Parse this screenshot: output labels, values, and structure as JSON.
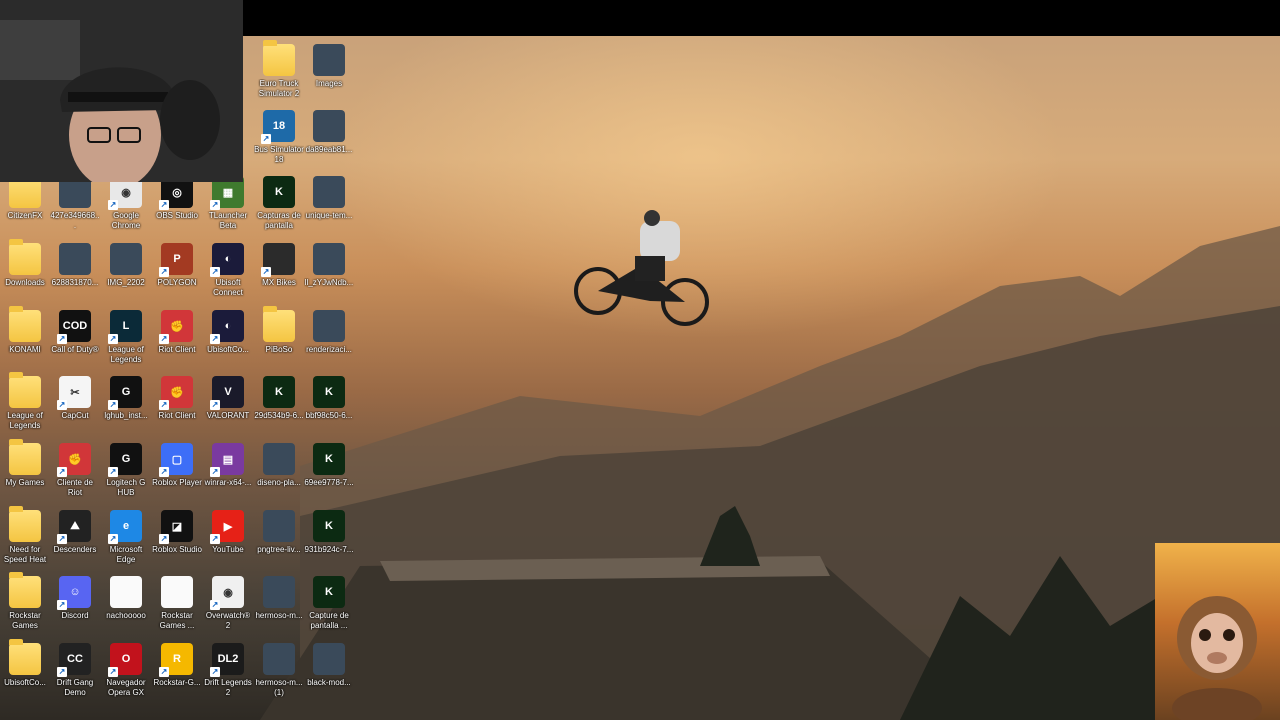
{
  "desktop": {
    "icons": [
      {
        "label": "Euro Truck Simulator 2",
        "icon": "folder-icon",
        "type": "folder"
      },
      {
        "label": "Images",
        "icon": "image-icon",
        "type": "image"
      },
      {
        "label": "Bus Simulator 18",
        "icon": "bus-simulator-icon",
        "type": "app"
      },
      {
        "label": "da89eab81...",
        "icon": "image-icon",
        "type": "image"
      },
      {
        "label": "CitizenFX",
        "icon": "folder-icon",
        "type": "folder"
      },
      {
        "label": "427e349668...",
        "icon": "image-icon",
        "type": "image"
      },
      {
        "label": "Google Chrome",
        "icon": "chrome-icon",
        "type": "app"
      },
      {
        "label": "OBS Studio",
        "icon": "obs-icon",
        "type": "app"
      },
      {
        "label": "TLauncher Beta",
        "icon": "tlauncher-icon",
        "type": "app"
      },
      {
        "label": "Capturas de pantalla",
        "icon": "kick-icon",
        "type": "image"
      },
      {
        "label": "unique-tem...",
        "icon": "image-icon",
        "type": "image"
      },
      {
        "label": "Downloads",
        "icon": "folder-icon",
        "type": "folder"
      },
      {
        "label": "628831870...",
        "icon": "image-icon",
        "type": "image"
      },
      {
        "label": "IMG_2202",
        "icon": "image-icon",
        "type": "image"
      },
      {
        "label": "POLYGON",
        "icon": "polygon-icon",
        "type": "app"
      },
      {
        "label": "Ubisoft Connect",
        "icon": "ubisoft-icon",
        "type": "app"
      },
      {
        "label": "MX Bikes",
        "icon": "mx-bikes-icon",
        "type": "app"
      },
      {
        "label": "ll_zYJwNdb...",
        "icon": "image-icon",
        "type": "image"
      },
      {
        "label": "KONAMI",
        "icon": "folder-icon",
        "type": "folder"
      },
      {
        "label": "Call of Duty®",
        "icon": "call-of-duty-icon",
        "type": "app"
      },
      {
        "label": "League of Legends",
        "icon": "league-of-legends-icon",
        "type": "app"
      },
      {
        "label": "Riot Client",
        "icon": "riot-client-icon",
        "type": "app"
      },
      {
        "label": "UbisoftCo...",
        "icon": "ubisoft-icon",
        "type": "app"
      },
      {
        "label": "PiBoSo",
        "icon": "folder-icon",
        "type": "folder"
      },
      {
        "label": "renderizaci...",
        "icon": "image-icon",
        "type": "image"
      },
      {
        "label": "League of Legends",
        "icon": "folder-icon",
        "type": "folder"
      },
      {
        "label": "CapCut",
        "icon": "capcut-icon",
        "type": "app"
      },
      {
        "label": "lghub_inst...",
        "icon": "logitech-icon",
        "type": "app"
      },
      {
        "label": "Riot Client",
        "icon": "riot-client-icon",
        "type": "app"
      },
      {
        "label": "VALORANT",
        "icon": "valorant-icon",
        "type": "app"
      },
      {
        "label": "29d534b9-6...",
        "icon": "kick-icon",
        "type": "image"
      },
      {
        "label": "bbf98c50-6...",
        "icon": "kick-icon",
        "type": "image"
      },
      {
        "label": "My Games",
        "icon": "folder-icon",
        "type": "folder"
      },
      {
        "label": "Cliente de Riot",
        "icon": "riot-client-icon",
        "type": "app"
      },
      {
        "label": "Logitech G HUB",
        "icon": "logitech-icon",
        "type": "app"
      },
      {
        "label": "Roblox Player",
        "icon": "roblox-icon",
        "type": "app"
      },
      {
        "label": "winrar-x64-...",
        "icon": "winrar-icon",
        "type": "app"
      },
      {
        "label": "diseno-pla...",
        "icon": "image-icon",
        "type": "image"
      },
      {
        "label": "69ee9778-7...",
        "icon": "kick-icon",
        "type": "image"
      },
      {
        "label": "Need for Speed Heat",
        "icon": "folder-icon",
        "type": "folder"
      },
      {
        "label": "Descenders",
        "icon": "descenders-icon",
        "type": "app"
      },
      {
        "label": "Microsoft Edge",
        "icon": "edge-icon",
        "type": "app"
      },
      {
        "label": "Roblox Studio",
        "icon": "roblox-studio-icon",
        "type": "app"
      },
      {
        "label": "YouTube",
        "icon": "youtube-icon",
        "type": "app"
      },
      {
        "label": "pngtree-liv...",
        "icon": "image-icon",
        "type": "image"
      },
      {
        "label": "931b924c-7...",
        "icon": "kick-icon",
        "type": "image"
      },
      {
        "label": "Rockstar Games",
        "icon": "folder-icon",
        "type": "folder"
      },
      {
        "label": "Discord",
        "icon": "discord-icon",
        "type": "app"
      },
      {
        "label": "nachooooo",
        "icon": "chrome-file-icon",
        "type": "file"
      },
      {
        "label": "Rockstar Games ...",
        "icon": "file-icon",
        "type": "file"
      },
      {
        "label": "Overwatch® 2",
        "icon": "overwatch-icon",
        "type": "app"
      },
      {
        "label": "hermoso-m...",
        "icon": "image-icon",
        "type": "image"
      },
      {
        "label": "Capture de pantalla ...",
        "icon": "kick-icon",
        "type": "image"
      },
      {
        "label": "UbisoftCo...",
        "icon": "folder-icon",
        "type": "folder"
      },
      {
        "label": "Drift Gang Demo",
        "icon": "drift-gang-icon",
        "type": "app"
      },
      {
        "label": "Navegador Opera GX",
        "icon": "opera-gx-icon",
        "type": "app"
      },
      {
        "label": "Rockstar-G...",
        "icon": "rockstar-icon",
        "type": "app"
      },
      {
        "label": "Drift Legends 2",
        "icon": "drift-legends-icon",
        "type": "app"
      },
      {
        "label": "hermoso-m... (1)",
        "icon": "image-icon",
        "type": "image"
      },
      {
        "label": "black-mod...",
        "icon": "image-icon",
        "type": "image"
      }
    ]
  }
}
